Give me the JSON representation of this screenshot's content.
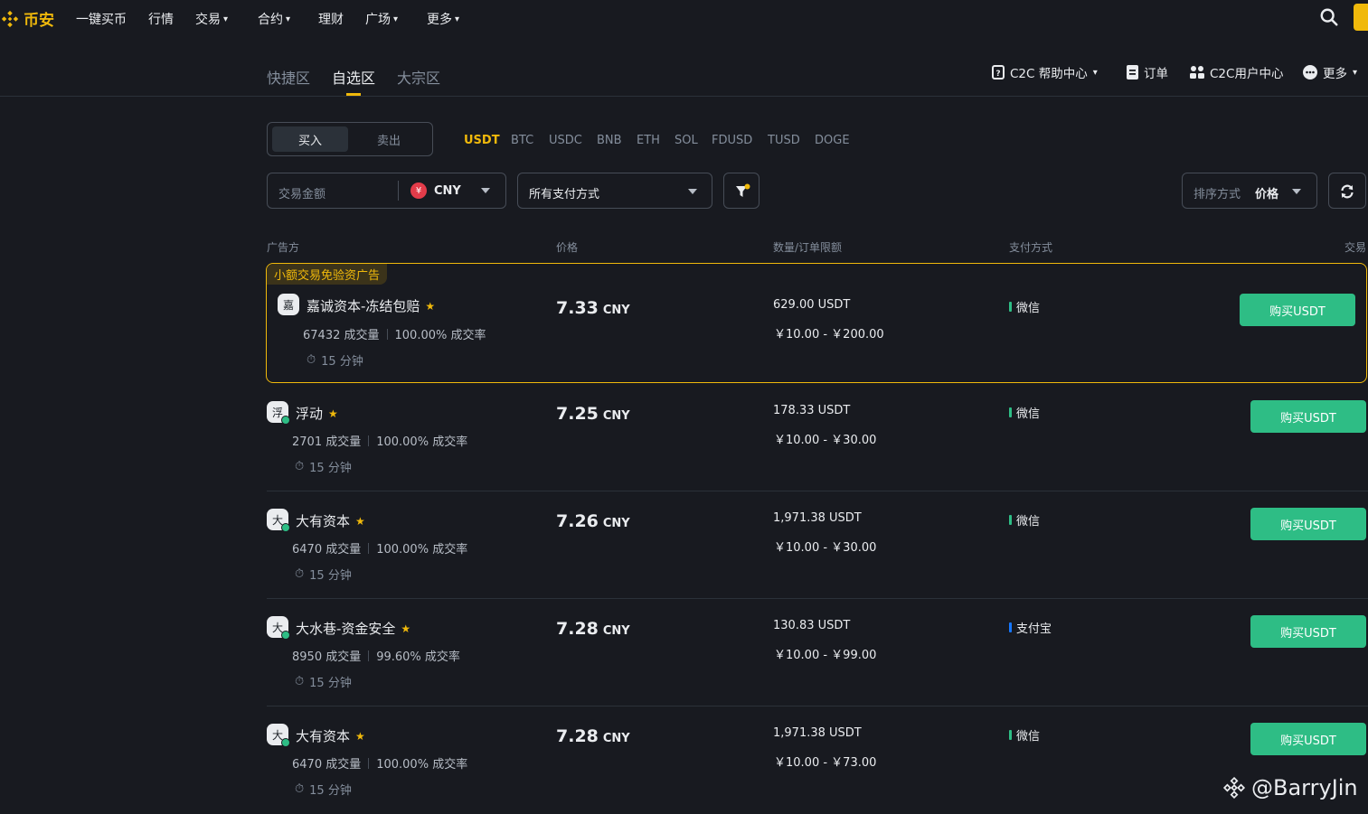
{
  "nav": {
    "logo_text": "币安",
    "items": [
      {
        "label": "一键买币",
        "has_chevron": false
      },
      {
        "label": "行情",
        "has_chevron": false
      },
      {
        "label": "交易",
        "has_chevron": true
      },
      {
        "label": "合约",
        "has_chevron": true
      },
      {
        "label": "理财",
        "has_chevron": false
      },
      {
        "label": "广场",
        "has_chevron": true
      },
      {
        "label": "更多",
        "has_chevron": true
      }
    ]
  },
  "subnav": {
    "tabs": [
      {
        "label": "快捷区",
        "active": false
      },
      {
        "label": "自选区",
        "active": true
      },
      {
        "label": "大宗区",
        "active": false
      }
    ],
    "right_links": [
      {
        "label": "C2C 帮助中心",
        "icon": "help-doc-icon",
        "has_chevron": true
      },
      {
        "label": "订单",
        "icon": "order-doc-icon",
        "has_chevron": false
      },
      {
        "label": "C2C用户中心",
        "icon": "user-center-icon",
        "has_chevron": false
      },
      {
        "label": "更多",
        "icon": "more-dots-icon",
        "has_chevron": true
      }
    ]
  },
  "controls": {
    "buy_label": "买入",
    "sell_label": "卖出",
    "coins": [
      "USDT",
      "BTC",
      "USDC",
      "BNB",
      "ETH",
      "SOL",
      "FDUSD",
      "TUSD",
      "DOGE"
    ],
    "active_coin": "USDT",
    "amount_placeholder": "交易金额",
    "fiat_symbol": "¥",
    "fiat": "CNY",
    "payment_select": "所有支付方式",
    "sort_label": "排序方式",
    "sort_value": "价格"
  },
  "table": {
    "headers": {
      "advertiser": "广告方",
      "price": "价格",
      "amount": "数量/订单限额",
      "payment": "支付方式",
      "trade": "交易"
    },
    "featured_tag": "小额交易免验资广告",
    "rows": [
      {
        "avatar": "嘉",
        "name": "嘉诚资本-冻结包赔",
        "orders": "67432 成交量",
        "rate": "100.00% 成交率",
        "time": "15 分钟",
        "price": "7.33",
        "currency": "CNY",
        "amount": "629.00 USDT",
        "limit": "￥10.00 - ￥200.00",
        "payment": "微信",
        "pay_color": "#2ebd85",
        "button": "购买USDT",
        "online": false
      },
      {
        "avatar": "浮",
        "name": "浮动",
        "orders": "2701 成交量",
        "rate": "100.00% 成交率",
        "time": "15 分钟",
        "price": "7.25",
        "currency": "CNY",
        "amount": "178.33 USDT",
        "limit": "￥10.00 - ￥30.00",
        "payment": "微信",
        "pay_color": "#2ebd85",
        "button": "购买USDT",
        "online": true
      },
      {
        "avatar": "大",
        "name": "大有资本",
        "orders": "6470 成交量",
        "rate": "100.00% 成交率",
        "time": "15 分钟",
        "price": "7.26",
        "currency": "CNY",
        "amount": "1,971.38 USDT",
        "limit": "￥10.00 - ￥30.00",
        "payment": "微信",
        "pay_color": "#2ebd85",
        "button": "购买USDT",
        "online": true
      },
      {
        "avatar": "大",
        "name": "大水巷-资金安全",
        "orders": "8950 成交量",
        "rate": "99.60% 成交率",
        "time": "15 分钟",
        "price": "7.28",
        "currency": "CNY",
        "amount": "130.83 USDT",
        "limit": "￥10.00 - ￥99.00",
        "payment": "支付宝",
        "pay_color": "#1677ff",
        "button": "购买USDT",
        "online": true
      },
      {
        "avatar": "大",
        "name": "大有资本",
        "orders": "6470 成交量",
        "rate": "100.00% 成交率",
        "time": "15 分钟",
        "price": "7.28",
        "currency": "CNY",
        "amount": "1,971.38 USDT",
        "limit": "￥10.00 - ￥73.00",
        "payment": "微信",
        "pay_color": "#2ebd85",
        "button": "购买USDT",
        "online": true
      }
    ]
  },
  "watermark": "@BarryJin",
  "colors": {
    "brand": "#f0b90b",
    "buy": "#2ebd85",
    "bg": "#181a20"
  }
}
